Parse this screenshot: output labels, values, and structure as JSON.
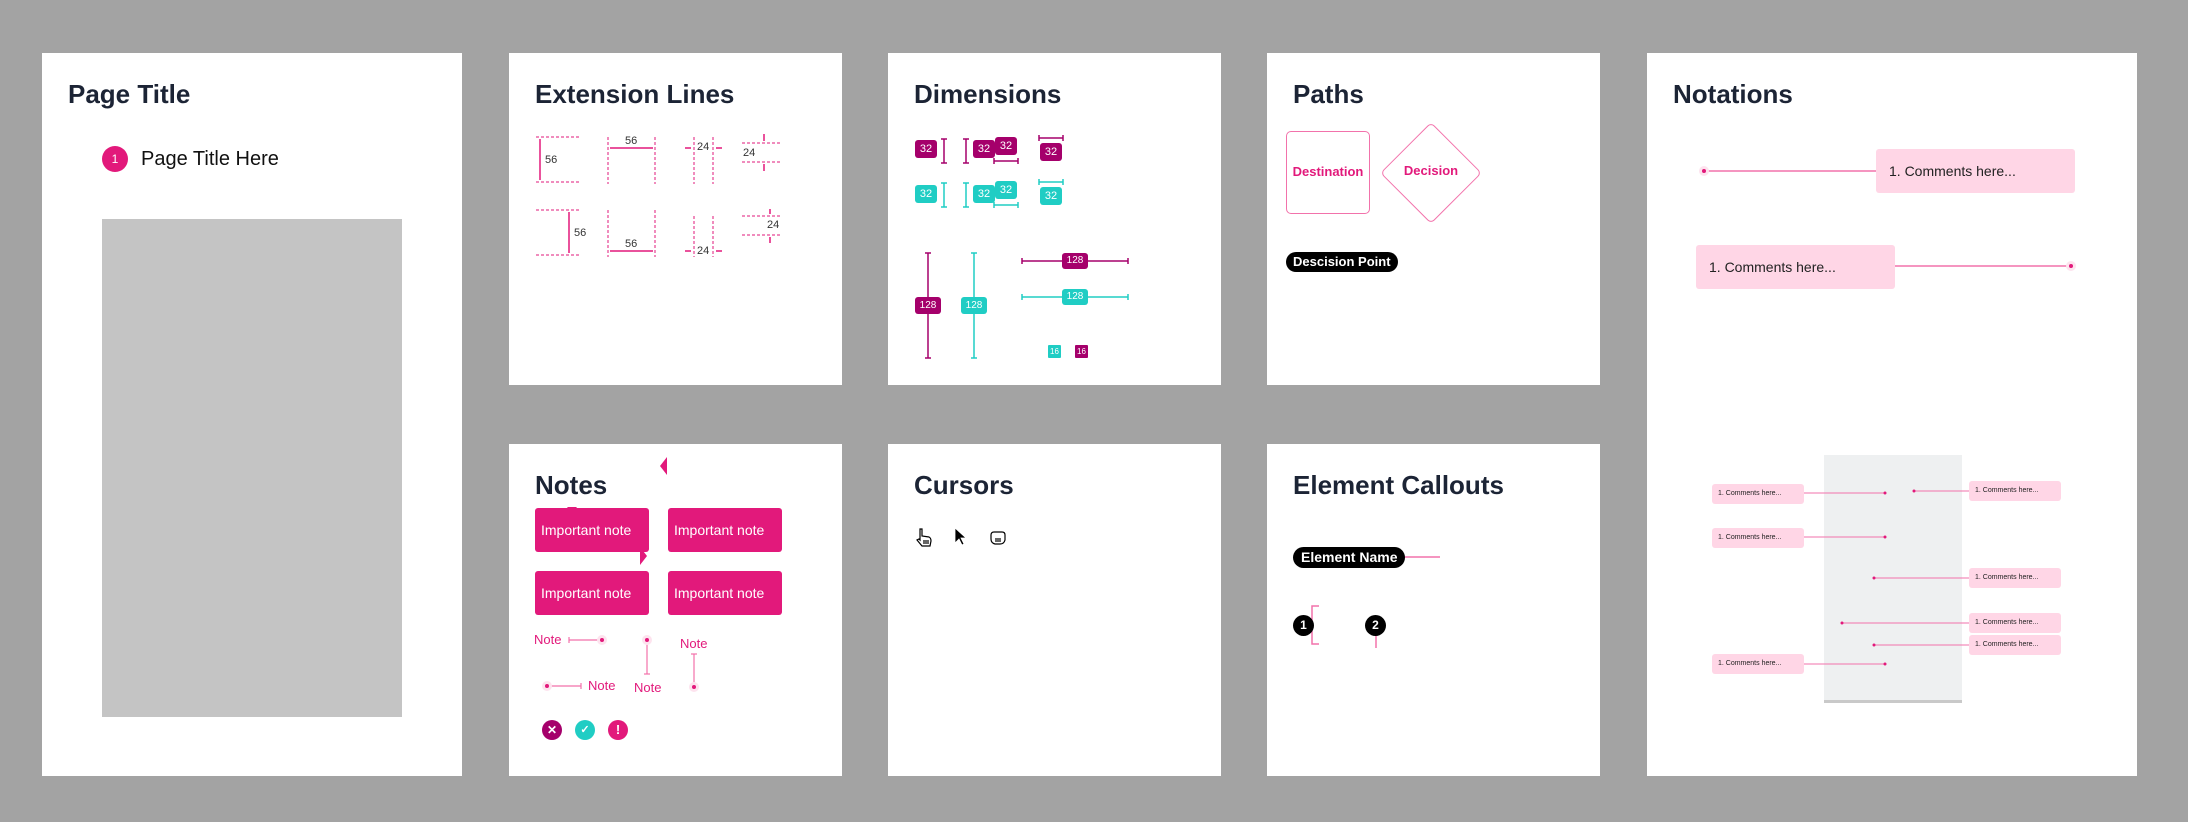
{
  "colors": {
    "accent_pink": "#e2197b",
    "magenta": "#a5006b",
    "cyan": "#20cdc4",
    "comment_bg": "#ffd6e6",
    "title_text": "#1c2435",
    "canvas_bg": "#a3a3a3"
  },
  "page_title_panel": {
    "title": "Page Title",
    "marker_number": "1",
    "heading": "Page Title Here"
  },
  "extension_lines_panel": {
    "title": "Extension Lines",
    "labels": [
      "56",
      "56",
      "24",
      "24",
      "56",
      "56",
      "24",
      "24"
    ]
  },
  "dimensions_panel": {
    "title": "Dimensions",
    "small_badges": [
      "32",
      "32",
      "32",
      "32",
      "32",
      "32",
      "32",
      "32"
    ],
    "large_badges": [
      "128",
      "128",
      "128",
      "128"
    ],
    "tiny_badges": [
      "16",
      "16"
    ]
  },
  "paths_panel": {
    "title": "Paths",
    "destination": "Destination",
    "decision": "Decision",
    "decision_point": "Descision Point"
  },
  "notations_panel": {
    "title": "Notations",
    "large_comments": [
      "1. Comments here...",
      "1. Comments here..."
    ],
    "small_comments": [
      "1. Comments here...",
      "1. Comments here...",
      "1. Comments here...",
      "1. Comments here...",
      "1. Comments here...",
      "1. Comments here...",
      "1. Comments here..."
    ]
  },
  "notes_panel": {
    "title": "Notes",
    "important_notes": [
      "Important note",
      "Important note",
      "Important note",
      "Important note"
    ],
    "note_labels": [
      "Note",
      "Note",
      "Note",
      "Note"
    ],
    "status_icons": [
      "error-icon",
      "check-icon",
      "warning-icon"
    ]
  },
  "cursors_panel": {
    "title": "Cursors",
    "cursors": [
      "pointer-hand-icon",
      "arrow-cursor-icon",
      "grab-hand-icon"
    ]
  },
  "element_callouts_panel": {
    "title": "Element Callouts",
    "element_name": "Element Name",
    "markers": [
      "1",
      "2"
    ]
  }
}
